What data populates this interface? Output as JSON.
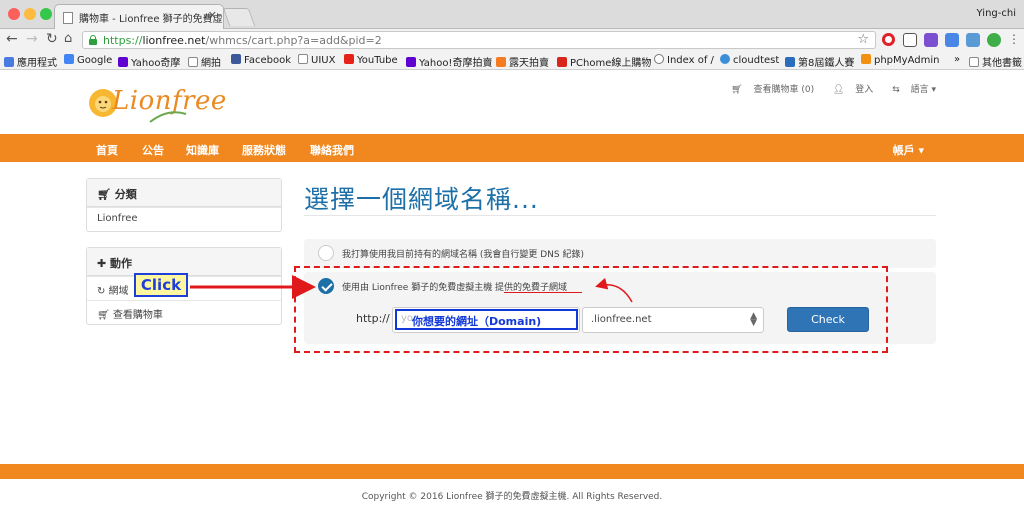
{
  "browser": {
    "tab_title": "購物車 - Lionfree 獅子的免費虛",
    "tab_close": "✕",
    "user": "Ying-chi",
    "url_protocol": "https://",
    "url_host": "lionfree.net",
    "url_path": "/whmcs/cart.php?a=add&pid=2"
  },
  "bookmarks": [
    {
      "label": "應用程式",
      "icon": "apps-icon",
      "color": "#4a7be0"
    },
    {
      "label": "Google",
      "icon": "google-icon",
      "color": "#4285f4"
    },
    {
      "label": "Yahoo奇摩",
      "icon": "yahoo-icon",
      "color": "#5f01d1"
    },
    {
      "label": "網拍",
      "icon": "folder-icon",
      "color": "#888888"
    },
    {
      "label": "Facebook",
      "icon": "facebook-icon",
      "color": "#3b5998"
    },
    {
      "label": "UIUX",
      "icon": "folder-icon",
      "color": "#888888"
    },
    {
      "label": "YouTube",
      "icon": "youtube-icon",
      "color": "#e62117"
    },
    {
      "label": "Yahoo!奇摩拍賣",
      "icon": "yahoo-icon",
      "color": "#5f01d1"
    },
    {
      "label": "露天拍賣",
      "icon": "ruten-icon",
      "color": "#f47b20"
    },
    {
      "label": "PChome線上購物",
      "icon": "pchome-icon",
      "color": "#d9261c"
    },
    {
      "label": "Index of /",
      "icon": "globe-icon",
      "color": "#777777"
    },
    {
      "label": "cloudtest",
      "icon": "cloud-icon",
      "color": "#3a8fd8"
    },
    {
      "label": "第8屆鐵人賽",
      "icon": "ithome-icon",
      "color": "#2a6ebb"
    },
    {
      "label": "phpMyAdmin",
      "icon": "phpmyadmin-icon",
      "color": "#f29111"
    },
    {
      "label": "其他書籤",
      "icon": "folder-icon",
      "color": "#888888"
    }
  ],
  "bookmarks_more": "»",
  "site": {
    "logo_text": "Lionfree",
    "cart_link": "查看購物車 (0)",
    "login_link": "登入",
    "language_link": "語言",
    "nav": [
      "首頁",
      "公告",
      "知識庫",
      "服務狀態",
      "聯絡我們"
    ],
    "account": "帳戶"
  },
  "sidebar": {
    "categories_title": "分類",
    "categories_items": [
      "Lionfree"
    ],
    "actions_title": "動作",
    "actions_items": [
      "網域",
      "查看購物車"
    ]
  },
  "main": {
    "title": "選擇一個網域名稱...",
    "option_own": "我打算使用我目前持有的網域名稱 (我會自行變更 DNS 紀錄)",
    "option_free": "使用由 Lionfree 獅子的免費虛擬主機 提供的免費子網域",
    "http_label": "http://",
    "domain_placeholder": "yo",
    "tld_value": ".lionfree.net",
    "check_button": "Check"
  },
  "annotations": {
    "click_label": "Click",
    "domain_hint": "你想要的網址（Domain)",
    "color_red": "#e01a1a",
    "color_blue": "#1238d8"
  },
  "footer": {
    "copyright": "Copyright © 2016 Lionfree 獅子的免費虛擬主機. All Rights Reserved."
  },
  "colors": {
    "brand_orange": "#f0871f",
    "title_blue": "#1d6fa8",
    "button_blue": "#2f75b6"
  }
}
